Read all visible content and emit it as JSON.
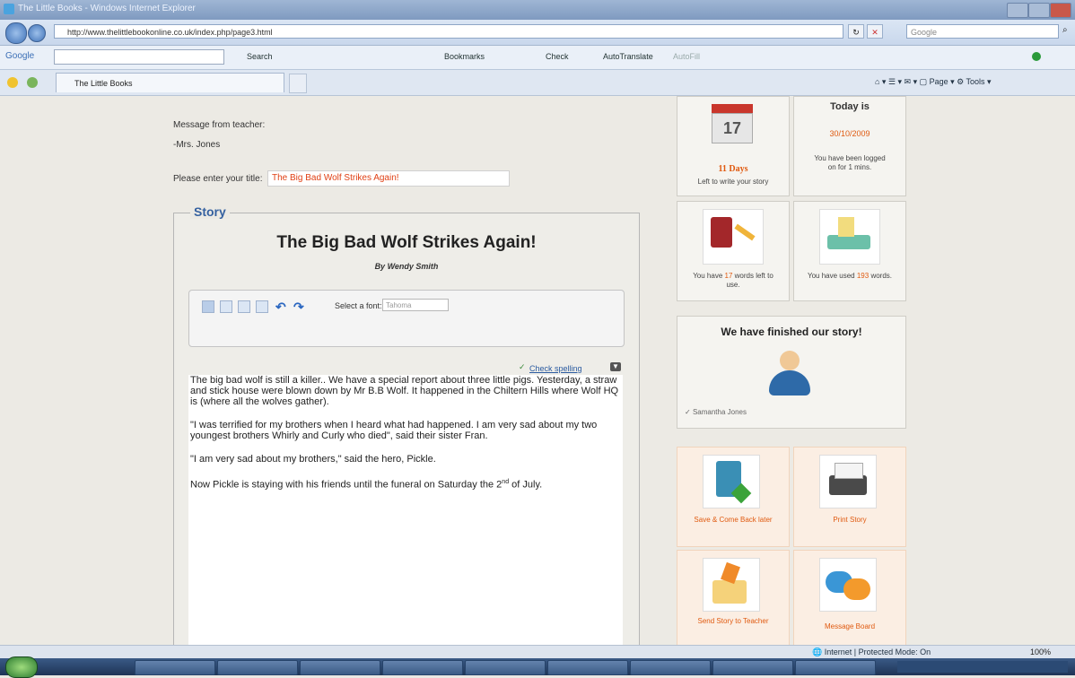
{
  "window": {
    "title": "The Little Books - Windows Internet Explorer"
  },
  "address": {
    "url": "http://www.thelittlebookonline.co.uk/index.php/page3.html",
    "search_placeholder": "Google"
  },
  "google_toolbar": {
    "logo": "Google",
    "items": [
      "Search",
      "Bookmarks",
      "Check",
      "AutoTranslate",
      "AutoFill"
    ]
  },
  "tab": {
    "label": "The Little Books"
  },
  "page": {
    "message_label": "Message from teacher:",
    "teacher_name": "-Mrs. Jones",
    "title_prompt": "Please enter your title:",
    "title_value": "The Big Bad Wolf Strikes Again!",
    "story_legend": "Story",
    "story_title": "The Big Bad Wolf Strikes Again!",
    "story_author": "By Wendy Smith",
    "font_label": "Select a font:",
    "font_value": "Tahoma",
    "check_spelling": "Check spelling",
    "story_paragraphs": [
      "The big bad wolf is still a killer.. We have a special report about three little pigs. Yesterday, a straw and stick house were blown down by Mr B.B Wolf. It happened in the Chiltern Hills where Wolf HQ is (where all the wolves gather).",
      "\"I was terrified for my brothers when I heard what had happened.  I am very sad about my two youngest brothers Whirly and Curly who died\", said their sister Fran.",
      "\"I am very sad about my brothers,\" said the hero, Pickle."
    ],
    "last_paragraph_before": "Now Pickle is staying with his friends until the funeral on Saturday the 2",
    "last_paragraph_sup": "nd",
    "last_paragraph_after": " of July."
  },
  "widgets": {
    "calendar_number": "17",
    "days_count": "11 Days",
    "days_text": "Left to write your story",
    "today_label": "Today is",
    "today_date": "30/10/2009",
    "logged_text": "You have been logged on for 1 mins.",
    "words_left_pre": "You have",
    "words_left_num": "17",
    "words_left_post": "words left to use.",
    "words_used_pre": "You have used",
    "words_used_num": "193",
    "words_used_post": "words.",
    "finished_title": "We have finished our story!",
    "finished_user": "Samantha Jones",
    "save_label": "Save & Come Back later",
    "print_label": "Print Story",
    "send_label": "Send Story to Teacher",
    "message_board_label": "Message Board"
  },
  "status": {
    "zone": "Internet | Protected Mode: On",
    "zoom": "100%"
  }
}
